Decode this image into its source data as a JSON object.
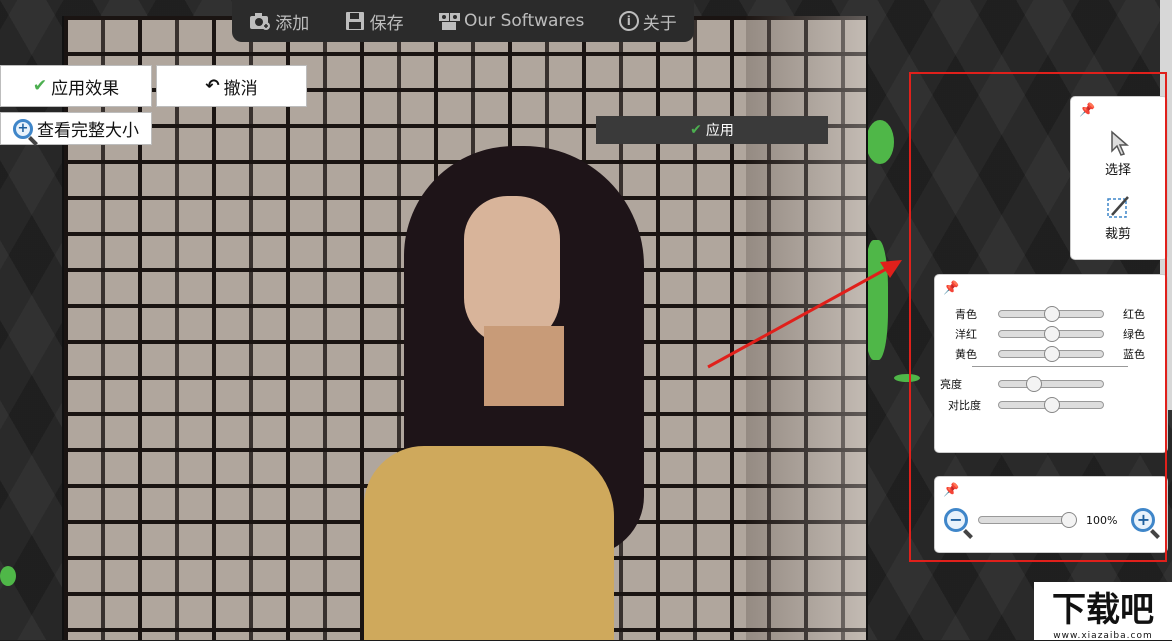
{
  "toolbar": {
    "add_label": "添加",
    "save_label": "保存",
    "softwares_label": "Our Softwares",
    "about_label": "关于"
  },
  "actions": {
    "apply_effect_label": "应用效果",
    "undo_label": "撤消",
    "full_size_label": "查看完整大小",
    "apply_label": "应用"
  },
  "tools_panel": {
    "select_label": "选择",
    "crop_label": "裁剪"
  },
  "color_panel": {
    "rows": [
      {
        "left": "青色",
        "right": "红色",
        "value": 0.5
      },
      {
        "left": "洋红",
        "right": "绿色",
        "value": 0.5
      },
      {
        "left": "黄色",
        "right": "蓝色",
        "value": 0.5
      }
    ],
    "brightness_label": "亮度",
    "brightness_value": 0.3,
    "contrast_label": "对比度",
    "contrast_value": 0.5
  },
  "zoom_panel": {
    "zoom_text": "100%",
    "zoom_value": 1.0
  },
  "watermark": {
    "title": "下载吧",
    "url": "www.xiazaiba.com"
  },
  "colors": {
    "accent_red": "#e0201b",
    "check_green": "#4caf50",
    "toolbar_bg": "#2b2b2b"
  }
}
